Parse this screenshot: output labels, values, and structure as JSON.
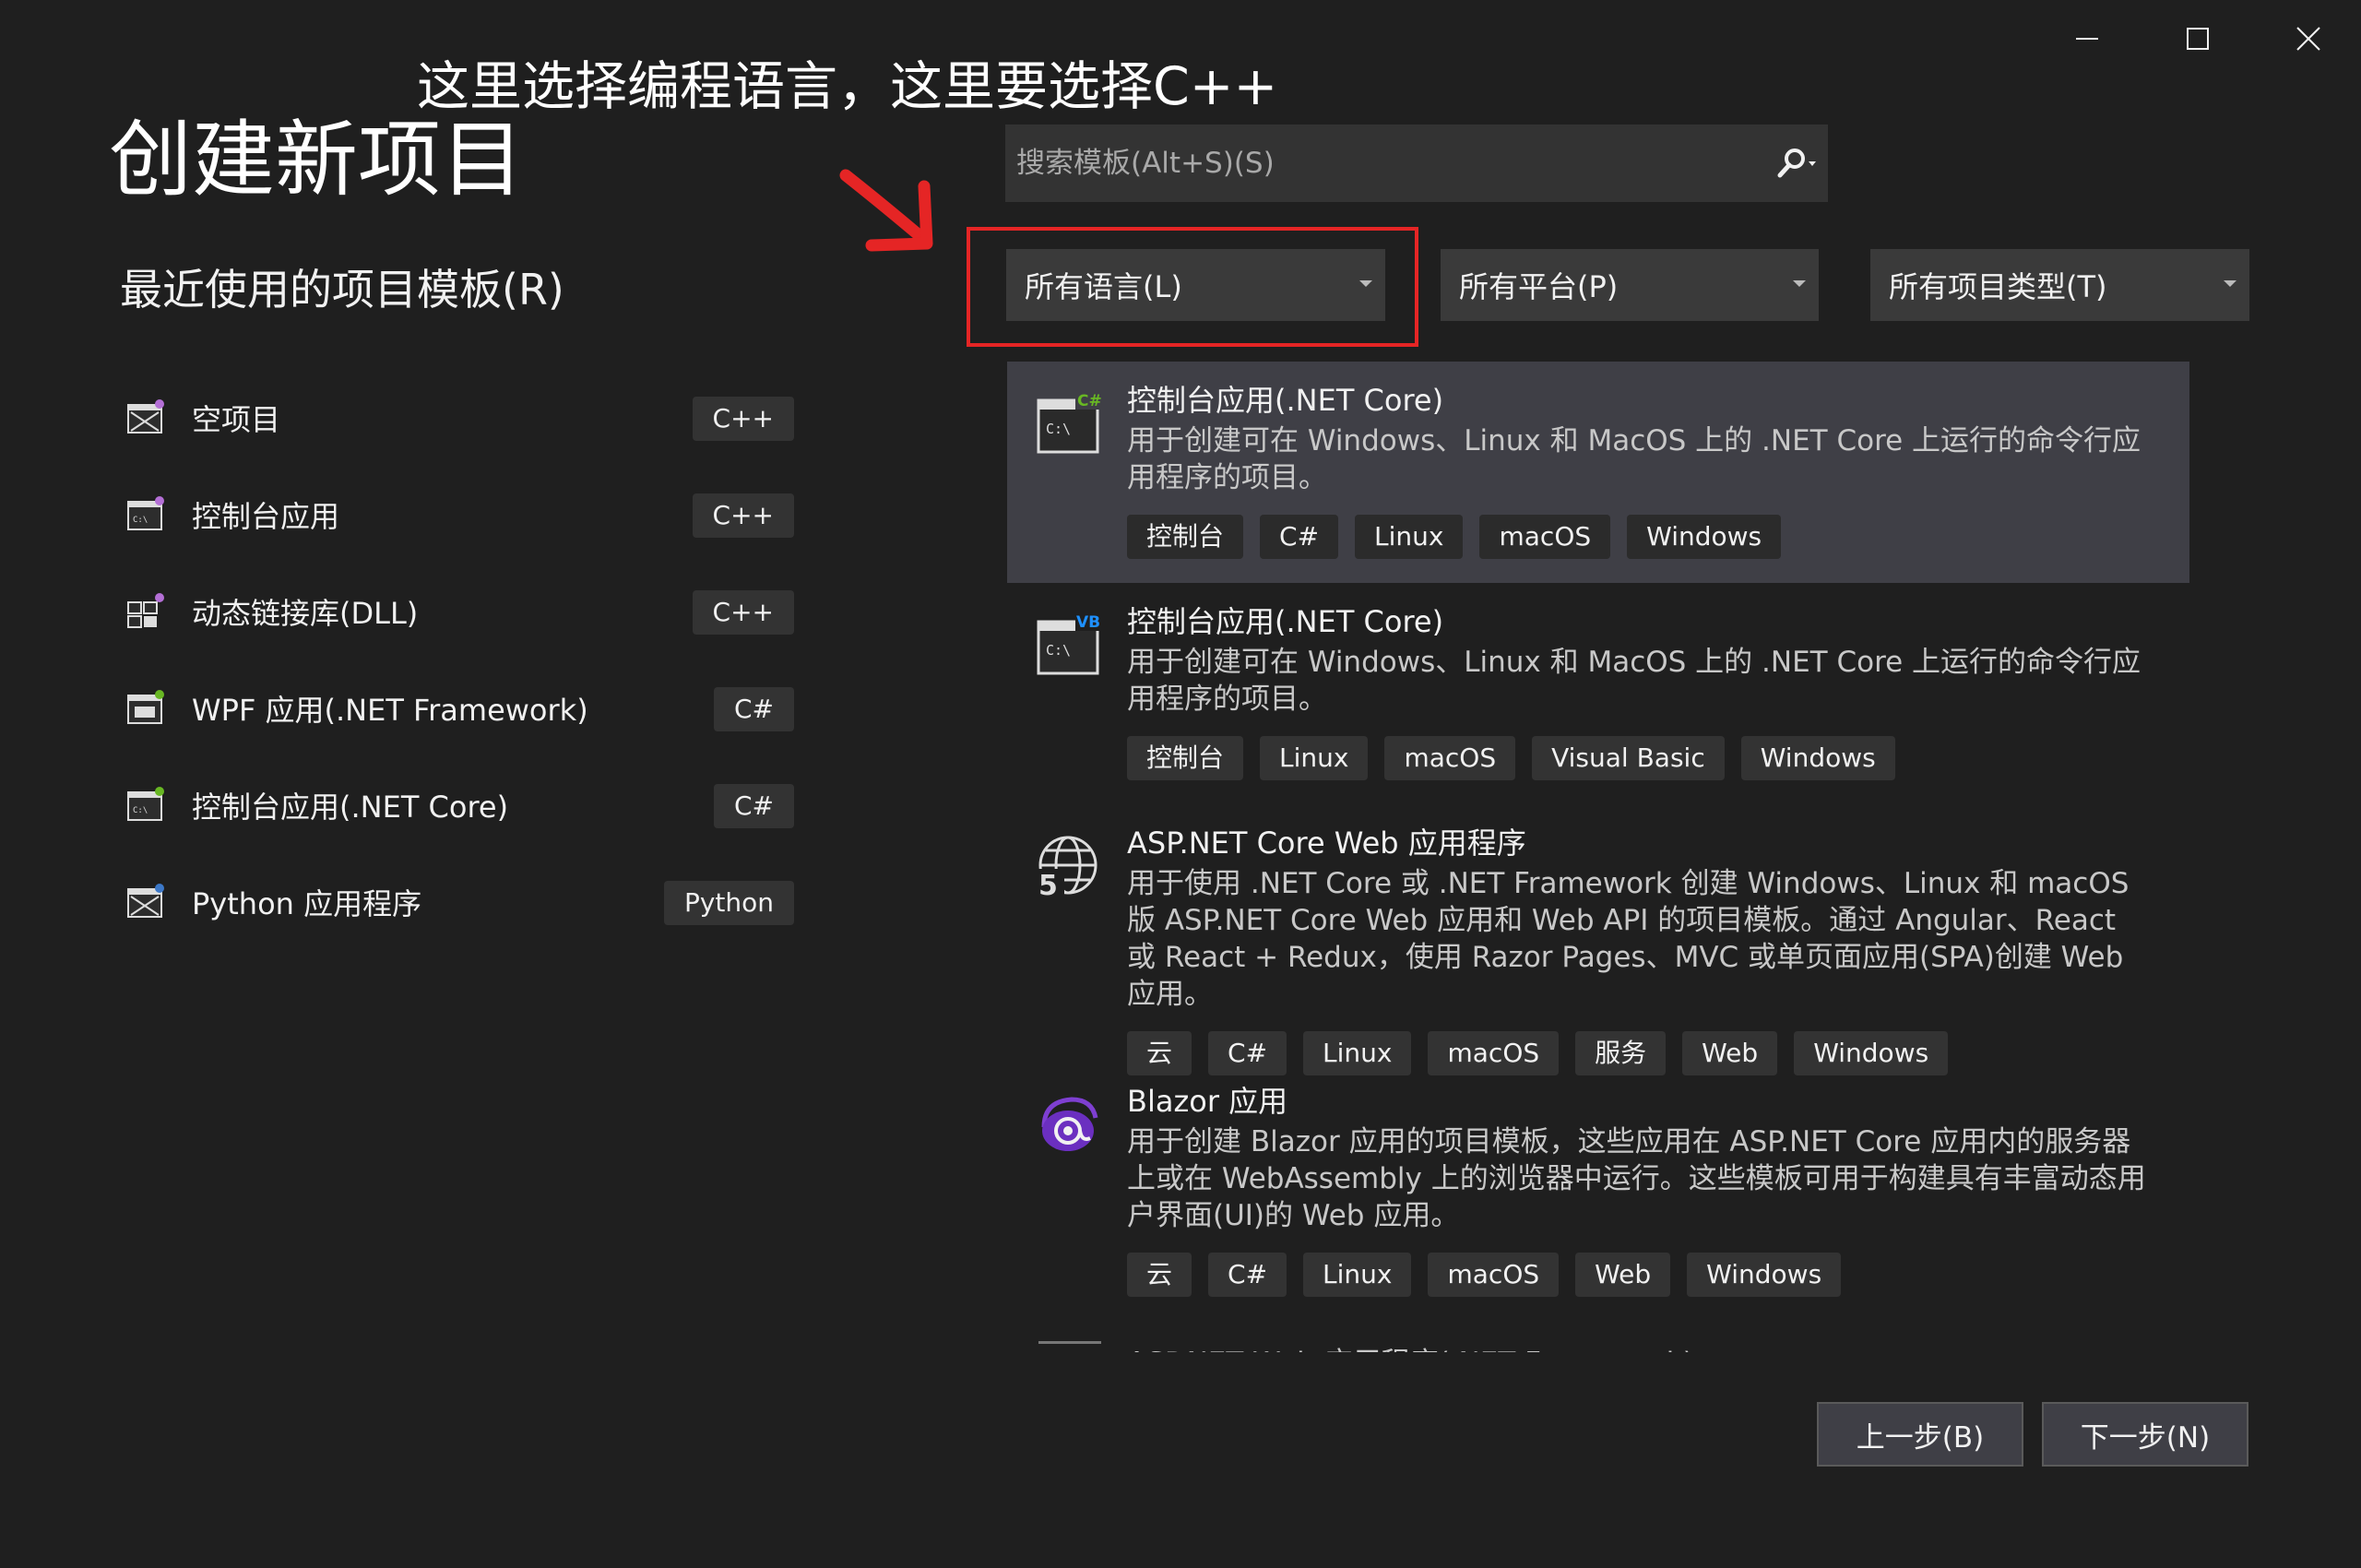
{
  "window_controls": {
    "minimize_icon": "minimize-icon",
    "maximize_icon": "maximize-icon",
    "close_icon": "close-icon"
  },
  "annotation": "这里选择编程语言，这里要选择C++",
  "page_title": "创建新项目",
  "recent": {
    "title": "最近使用的项目模板(R)",
    "items": [
      {
        "label": "空项目",
        "lang": "C++",
        "icon": "empty-project-icon"
      },
      {
        "label": "控制台应用",
        "lang": "C++",
        "icon": "console-app-icon"
      },
      {
        "label": "动态链接库(DLL)",
        "lang": "C++",
        "icon": "dll-icon"
      },
      {
        "label": "WPF 应用(.NET Framework)",
        "lang": "C#",
        "icon": "wpf-app-icon"
      },
      {
        "label": "控制台应用(.NET Core)",
        "lang": "C#",
        "icon": "console-app-icon"
      },
      {
        "label": "Python 应用程序",
        "lang": "Python",
        "icon": "python-app-icon"
      }
    ]
  },
  "search": {
    "placeholder": "搜索模板(Alt+S)(S)",
    "value": ""
  },
  "filters": {
    "language": "所有语言(L)",
    "platform": "所有平台(P)",
    "project_type": "所有项目类型(T)"
  },
  "templates": [
    {
      "title": "控制台应用(.NET Core)",
      "description": "用于创建可在 Windows、Linux 和 MacOS 上的 .NET Core 上运行的命令行应用程序的项目。",
      "tags": [
        "控制台",
        "C#",
        "Linux",
        "macOS",
        "Windows"
      ],
      "icon": "csharp-console-icon",
      "badge": "C#"
    },
    {
      "title": "控制台应用(.NET Core)",
      "description": "用于创建可在 Windows、Linux 和 MacOS 上的 .NET Core 上运行的命令行应用程序的项目。",
      "tags": [
        "控制台",
        "Linux",
        "macOS",
        "Visual Basic",
        "Windows"
      ],
      "icon": "vb-console-icon",
      "badge": "VB"
    },
    {
      "title": "ASP.NET Core Web 应用程序",
      "description": "用于使用 .NET Core 或 .NET Framework 创建 Windows、Linux 和 macOS 版 ASP.NET Core Web 应用和 Web API 的项目模板。通过 Angular、React 或 React + Redux，使用 Razor Pages、MVC 或单页面应用(SPA)创建 Web 应用。",
      "tags": [
        "云",
        "C#",
        "Linux",
        "macOS",
        "服务",
        "Web",
        "Windows"
      ],
      "icon": "globe-icon"
    },
    {
      "title": "Blazor 应用",
      "description": "用于创建 Blazor 应用的项目模板，这些应用在 ASP.NET Core 应用内的服务器上或在 WebAssembly 上的浏览器中运行。这些模板可用于构建具有丰富动态用户界面(UI)的 Web 应用。",
      "tags": [
        "云",
        "C#",
        "Linux",
        "macOS",
        "Web",
        "Windows"
      ],
      "icon": "blazor-icon"
    }
  ],
  "cutoff_title": "ASP.NET Web 应用程序(.NET Framework)",
  "buttons": {
    "back": "上一步(B)",
    "next": "下一步(N)"
  },
  "colors": {
    "background": "#1f1f1f",
    "panel": "#333333",
    "selected": "#3f3f46",
    "annotation_red": "#e52525",
    "csharp_badge": "#68b723",
    "vb_badge": "#1e90ff",
    "blazor": "#7e3fd1"
  }
}
